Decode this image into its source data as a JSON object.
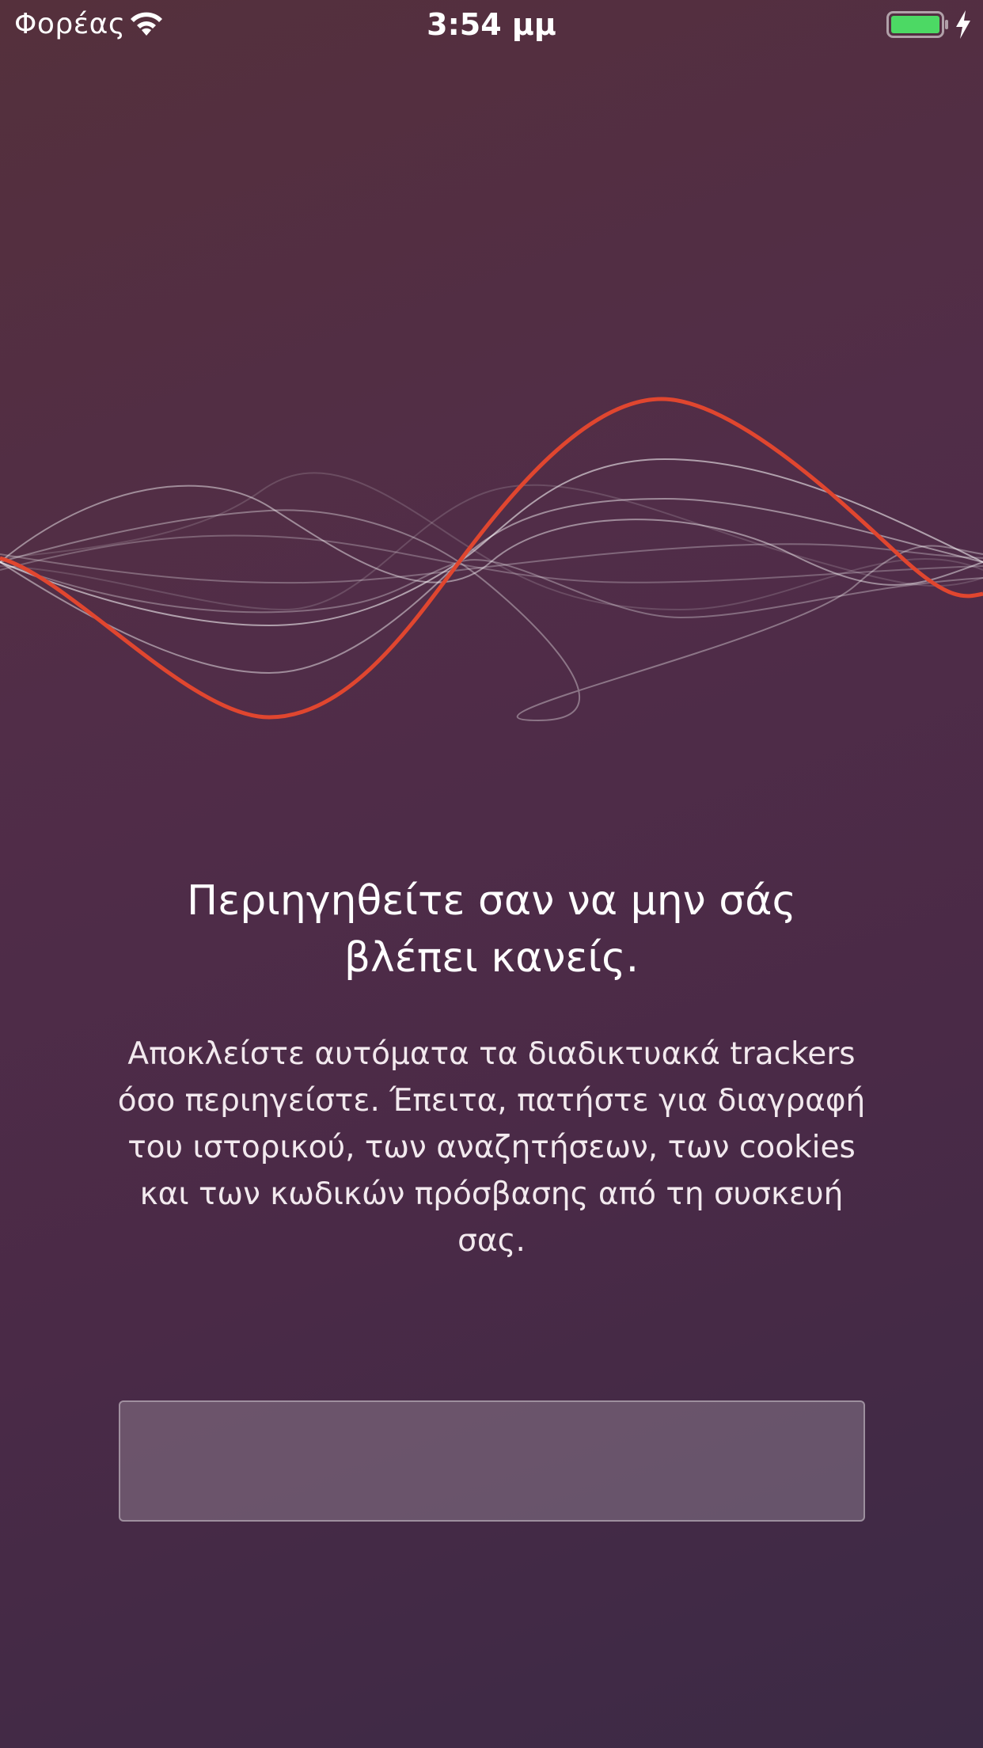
{
  "status_bar": {
    "carrier": "Φορέας",
    "time": "3:54 μμ",
    "icons": [
      "wifi-icon",
      "battery-icon",
      "charging-icon"
    ],
    "battery_color": "#4cd964"
  },
  "illustration": {
    "name": "sound-wave-illustration",
    "accent_color": "#e0462f",
    "line_color": "#d8c8d4"
  },
  "onboarding": {
    "headline_lines": [
      "Περιηγηθείτε σαν να μην σάς",
      "βλέπει κανείς."
    ],
    "description_lines": [
      "Αποκλείστε αυτόματα τα διαδικτυακά trackers",
      "όσο περιηγείστε. Έπειτα, πατήστε για διαγραφή",
      "του ιστορικού, των αναζητήσεων, των cookies",
      "και των κωδικών πρόσβασης από τη συσκευή",
      "σας."
    ]
  },
  "theme": {
    "background_top": "#55303c",
    "background_bottom": "#3c2a45",
    "button_fill": "rgba(255,255,255,0.2)"
  }
}
